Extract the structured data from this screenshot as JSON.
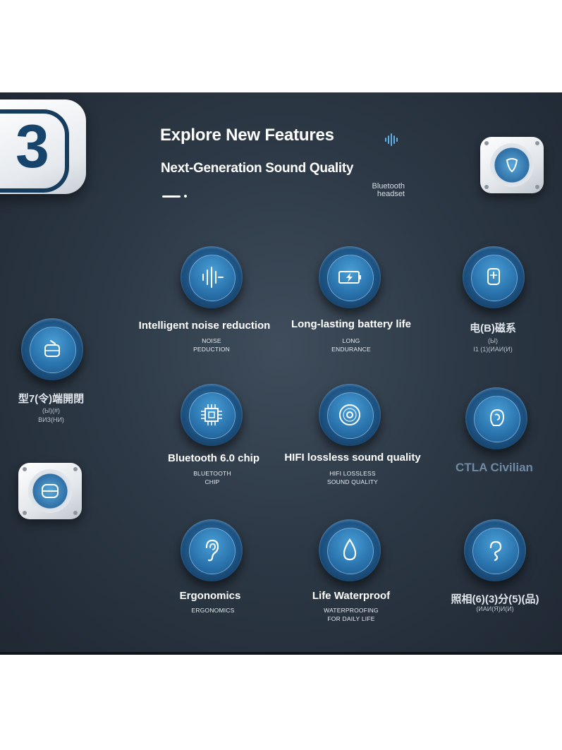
{
  "header": {
    "title": "Explore New Features",
    "subtitle": "Next-Generation Sound Quality",
    "tag": "Bluetooth headset",
    "badge": "3"
  },
  "features": [
    {
      "title": "Intelligent noise reduction",
      "sub1": "NOISE",
      "sub2": "PEDUCTION",
      "icon": "soundwave-icon"
    },
    {
      "title": "Long-lasting battery life",
      "sub1": "LONG",
      "sub2": "ENDURANCE",
      "icon": "battery-icon"
    },
    {
      "title": "Bluetooth 6.0 chip",
      "sub1": "BLUETOOTH",
      "sub2": "CHIP",
      "icon": "chip-icon"
    },
    {
      "title": "HIFI lossless sound quality",
      "sub1": "HIFI LOSSLESS",
      "sub2": "SOUND QUALITY",
      "icon": "disc-icon"
    },
    {
      "title": "Ergonomics",
      "sub1": "ERGONOMICS",
      "sub2": "",
      "icon": "ear-icon"
    },
    {
      "title": "Life Waterproof",
      "sub1": "WATERPROOFING",
      "sub2": "FOR DAILY LIFE",
      "icon": "water-drop-icon"
    }
  ],
  "side": {
    "left_title": "型7(令)端開閉",
    "left_sub1": "(Ы)(#)",
    "left_sub2": "ВИЗ(НИ)",
    "right1_title": "电(B)磁系",
    "right1_sub1": "(Ы)",
    "right1_sub2": "I1  (1)(ИАИ(И)",
    "right2_title": "CTLA Civilian",
    "right3_title": "照相(6)(3)分(5)(品)",
    "right3_sub": "(ИАИ(Я)И(И)"
  },
  "colors": {
    "background": "#2d3946",
    "accent": "#2a73ad",
    "text": "#ffffff",
    "muted": "#6f8aa3"
  }
}
